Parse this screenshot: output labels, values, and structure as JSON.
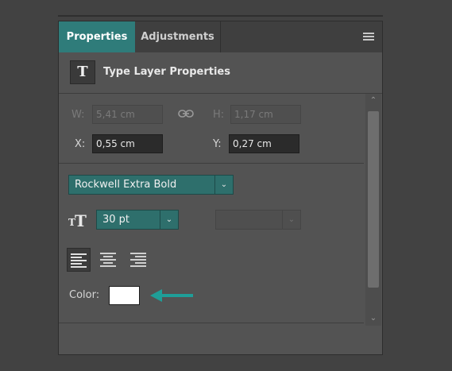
{
  "tabs": [
    {
      "label": "Properties"
    },
    {
      "label": "Adjustments"
    }
  ],
  "header": {
    "icon_letter": "T",
    "title": "Type Layer Properties"
  },
  "transform": {
    "w_label": "W:",
    "w_value": "5,41 cm",
    "h_label": "H:",
    "h_value": "1,17 cm",
    "x_label": "X:",
    "x_value": "0,55 cm",
    "y_label": "Y:",
    "y_value": "0,27 cm"
  },
  "font": {
    "family": "Rockwell Extra Bold"
  },
  "size": {
    "value": "30 pt",
    "style_placeholder": ""
  },
  "align": [
    {
      "name": "align-left-button",
      "active": true
    },
    {
      "name": "align-center-button",
      "active": false
    },
    {
      "name": "align-right-button",
      "active": false
    }
  ],
  "color": {
    "label": "Color:",
    "swatch": "#ffffff",
    "arrow_color": "#1f9e98"
  },
  "colors": {
    "accent": "#2f7c7a",
    "panel": "#535353",
    "background": "#424242"
  }
}
